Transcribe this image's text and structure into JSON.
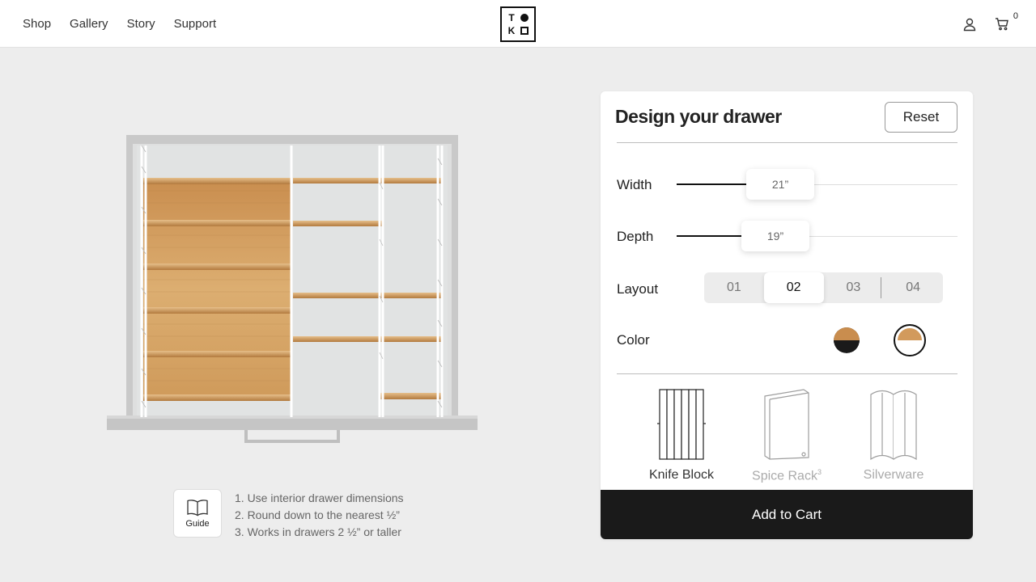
{
  "nav": {
    "items": [
      "Shop",
      "Gallery",
      "Story",
      "Support"
    ]
  },
  "logo": {
    "letter_t": "T",
    "letter_k": "K"
  },
  "header": {
    "cart_count": "0",
    "icons": [
      "user-icon",
      "cart-icon"
    ]
  },
  "guide": {
    "button_label": "Guide",
    "notes": [
      "1. Use interior drawer dimensions",
      "2. Round down to the nearest ½”",
      "3. Works in drawers 2 ½” or taller"
    ]
  },
  "panel": {
    "title": "Design your drawer",
    "reset_label": "Reset",
    "width": {
      "label": "Width",
      "value": "21”",
      "fraction": 0.33
    },
    "depth": {
      "label": "Depth",
      "value": "19”",
      "fraction": 0.3
    },
    "layout": {
      "label": "Layout",
      "options": [
        "01",
        "02",
        "03",
        "04"
      ],
      "selected": "02"
    },
    "color": {
      "label": "Color",
      "options": [
        "bamboo-black",
        "bamboo-white"
      ],
      "selected": "bamboo-white"
    },
    "accessories": [
      {
        "name": "Knife Block",
        "sup": "",
        "active": true
      },
      {
        "name": "Spice Rack",
        "sup": "3",
        "active": false
      },
      {
        "name": "Silverware",
        "sup": "",
        "active": false
      }
    ],
    "add_to_cart_label": "Add to Cart"
  },
  "colors": {
    "bamboo": "#d9a96a",
    "bamboo_dark": "#b98546",
    "black": "#1a1a1a",
    "panel_bg": "#ffffff",
    "page_bg": "#ededed"
  }
}
